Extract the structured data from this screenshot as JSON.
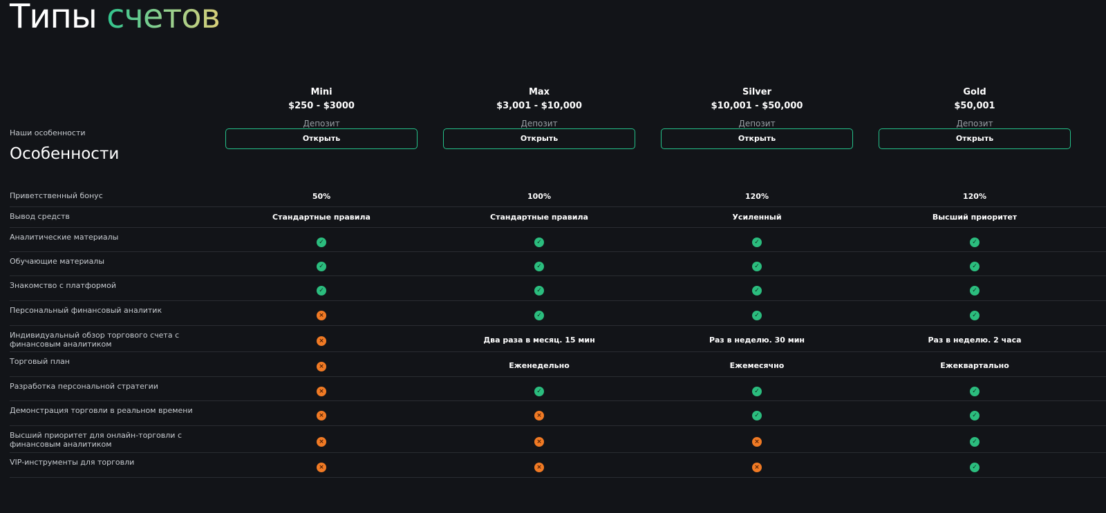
{
  "title": {
    "main": "Типы",
    "accent": "счетов"
  },
  "features": {
    "subtitle": "Наши особенности",
    "heading": "Особенности"
  },
  "plans": [
    {
      "name": "Mini",
      "range": "$250 - $3000",
      "deposit_label": "Депозит",
      "button": "Открыть"
    },
    {
      "name": "Max",
      "range": "$3,001 - $10,000",
      "deposit_label": "Депозит",
      "button": "Открыть"
    },
    {
      "name": "Silver",
      "range": "$10,001 - $50,000",
      "deposit_label": "Депозит",
      "button": "Открыть"
    },
    {
      "name": "Gold",
      "range": "$50,001",
      "deposit_label": "Депозит",
      "button": "Открыть"
    }
  ],
  "rows": [
    {
      "label": "Приветственный бонус",
      "cells": [
        {
          "text": "50%"
        },
        {
          "text": "100%"
        },
        {
          "text": "120%"
        },
        {
          "text": "120%"
        }
      ]
    },
    {
      "label": "Вывод средств",
      "cells": [
        {
          "text": "Стандартные правила"
        },
        {
          "text": "Стандартные правила"
        },
        {
          "text": "Усиленный"
        },
        {
          "text": "Высший приоритет"
        }
      ]
    },
    {
      "label": "Аналитические материалы",
      "cells": [
        {
          "icon": "yes"
        },
        {
          "icon": "yes"
        },
        {
          "icon": "yes"
        },
        {
          "icon": "yes"
        }
      ]
    },
    {
      "label": "Обучающие материалы",
      "cells": [
        {
          "icon": "yes"
        },
        {
          "icon": "yes"
        },
        {
          "icon": "yes"
        },
        {
          "icon": "yes"
        }
      ]
    },
    {
      "label": "Знакомство с платформой",
      "cells": [
        {
          "icon": "yes"
        },
        {
          "icon": "yes"
        },
        {
          "icon": "yes"
        },
        {
          "icon": "yes"
        }
      ]
    },
    {
      "label": "Персональный финансовый аналитик",
      "cells": [
        {
          "icon": "no"
        },
        {
          "icon": "yes"
        },
        {
          "icon": "yes"
        },
        {
          "icon": "yes"
        }
      ]
    },
    {
      "label": "Индивидуальный обзор торгового счета с финансовым аналитиком",
      "cells": [
        {
          "icon": "no"
        },
        {
          "text": "Два раза в месяц. 15 мин"
        },
        {
          "text": "Раз в неделю. 30 мин"
        },
        {
          "text": "Раз в неделю. 2 часа"
        }
      ]
    },
    {
      "label": "Торговый план",
      "cells": [
        {
          "icon": "no"
        },
        {
          "text": "Еженедельно"
        },
        {
          "text": "Ежемесячно"
        },
        {
          "text": "Ежеквартально"
        }
      ]
    },
    {
      "label": "Разработка персональной стратегии",
      "cells": [
        {
          "icon": "no"
        },
        {
          "icon": "yes"
        },
        {
          "icon": "yes"
        },
        {
          "icon": "yes"
        }
      ]
    },
    {
      "label": "Демонстрация торговли в реальном времени",
      "cells": [
        {
          "icon": "no"
        },
        {
          "icon": "no"
        },
        {
          "icon": "yes"
        },
        {
          "icon": "yes"
        }
      ]
    },
    {
      "label": "Высший приоритет для онлайн-торговли с финансовым аналитиком",
      "cells": [
        {
          "icon": "no"
        },
        {
          "icon": "no"
        },
        {
          "icon": "no"
        },
        {
          "icon": "yes"
        }
      ]
    },
    {
      "label": "VIP-инструменты для торговли",
      "cells": [
        {
          "icon": "no"
        },
        {
          "icon": "no"
        },
        {
          "icon": "no"
        },
        {
          "icon": "yes"
        }
      ]
    }
  ],
  "icons": {
    "yes": {
      "name": "check-circle-icon",
      "color": "#2bbd7e",
      "glyph": "✓"
    },
    "no": {
      "name": "cross-circle-icon",
      "color": "#f07a24",
      "glyph": "×"
    }
  },
  "colors": {
    "background": "#121418",
    "button_border": "#25c28a",
    "divider": "#2a2d32"
  }
}
